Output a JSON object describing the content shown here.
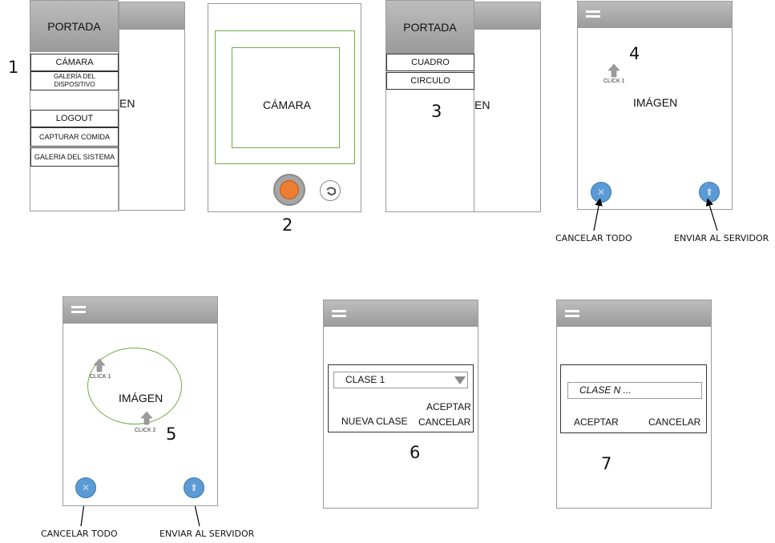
{
  "s1": {
    "title": "PORTADA",
    "number": "1",
    "behind_text": "EN",
    "items": [
      "CÁMARA",
      "GALERÍA DEL DISPOSITIVO",
      "LOGOUT",
      "CAPTURAR COMIDA",
      "GALERIA DEL SISTEMA"
    ]
  },
  "s2": {
    "label": "CÁMARA",
    "number": "2"
  },
  "s3": {
    "title": "PORTADA",
    "items": [
      "CUADRO",
      "CIRCULO"
    ],
    "number": "3",
    "behind_text": "EN"
  },
  "s4": {
    "number": "4",
    "click": "CLICK 1",
    "label": "IMÁGEN",
    "cancel": "CANCELAR TODO",
    "send": "ENVIAR AL SERVIDOR"
  },
  "s5": {
    "click1": "CLICK 1",
    "label": "IMÁGEN",
    "click2": "CLICK 2",
    "number": "5",
    "cancel": "CANCELAR TODO",
    "send": "ENVIAR AL SERVIDOR"
  },
  "s6": {
    "select": "CLASE 1",
    "accept": "ACEPTAR",
    "new_class": "NUEVA CLASE",
    "cancel": "CANCELAR",
    "number": "6"
  },
  "s7": {
    "input": "CLASE N ...",
    "accept": "ACEPTAR",
    "cancel": "CANCELAR",
    "number": "7"
  },
  "colors": {
    "header_gray": "#a9a9a9",
    "green": "#70ad47",
    "blue_button": "#5b9bd5",
    "orange_button": "#ed7d31"
  }
}
